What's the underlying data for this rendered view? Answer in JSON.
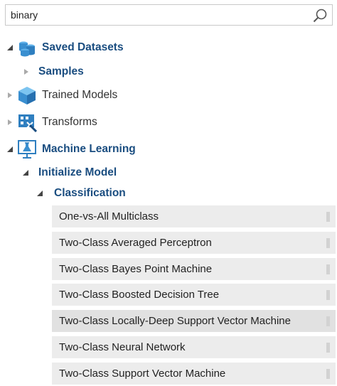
{
  "search": {
    "value": "binary"
  },
  "tree": {
    "saved_datasets": "Saved Datasets",
    "samples": "Samples",
    "trained_models": "Trained Models",
    "transforms": "Transforms",
    "machine_learning": "Machine Learning",
    "initialize_model": "Initialize Model",
    "classification": "Classification"
  },
  "modules": [
    "One-vs-All Multiclass",
    "Two-Class Averaged Perceptron",
    "Two-Class Bayes Point Machine",
    "Two-Class Boosted Decision Tree",
    "Two-Class Locally-Deep Support Vector Machine",
    "Two-Class Neural Network",
    "Two-Class Support Vector Machine"
  ],
  "colors": {
    "accent": "#1a4d80",
    "icon_blue": "#3a8fd0",
    "module_bg": "#ececec"
  }
}
